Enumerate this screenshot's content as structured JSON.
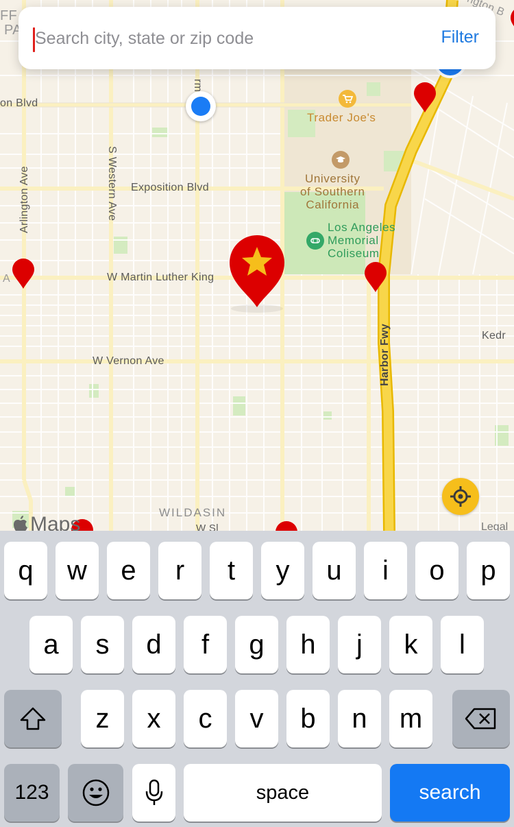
{
  "search": {
    "placeholder": "Search city, state or zip code",
    "filter_label": "Filter"
  },
  "map": {
    "streets": {
      "blvd_left": "on Blvd",
      "exposition": "Exposition Blvd",
      "mlk": "W Martin Luther King",
      "vernon": "W Vernon Ave",
      "arlington": "Arlington Ave",
      "western": "S Western Ave",
      "normandie": "rma Ave",
      "harbor": "Harbor Fwy",
      "kedr": "Kedr",
      "top_left": "FF",
      "top_left2": "PA",
      "top_right": "ngton B",
      "partial_left": "A",
      "bottom_street": "W Sl"
    },
    "pois": {
      "trader_joes": "Trader Joe's",
      "usc": "University\nof Southern\nCalifornia",
      "coliseum": "Los Angeles\nMemorial\nColiseum"
    },
    "district": "WILDASIN",
    "brand": "Maps",
    "legal": "Legal",
    "colors": {
      "pin": "#e00000",
      "star": "#f6be1b",
      "freeway": "#f7d23b",
      "park": "#c9e6b0",
      "campus": "#efe4cf"
    }
  },
  "keyboard": {
    "row1": [
      "q",
      "w",
      "e",
      "r",
      "t",
      "y",
      "u",
      "i",
      "o",
      "p"
    ],
    "row2": [
      "a",
      "s",
      "d",
      "f",
      "g",
      "h",
      "j",
      "k",
      "l"
    ],
    "row3": [
      "z",
      "x",
      "c",
      "v",
      "b",
      "n",
      "m"
    ],
    "numbers_label": "123",
    "space_label": "space",
    "search_label": "search",
    "shift_icon": "shift-icon",
    "delete_icon": "delete-icon",
    "emoji_icon": "emoji-icon",
    "mic_icon": "microphone-icon"
  }
}
